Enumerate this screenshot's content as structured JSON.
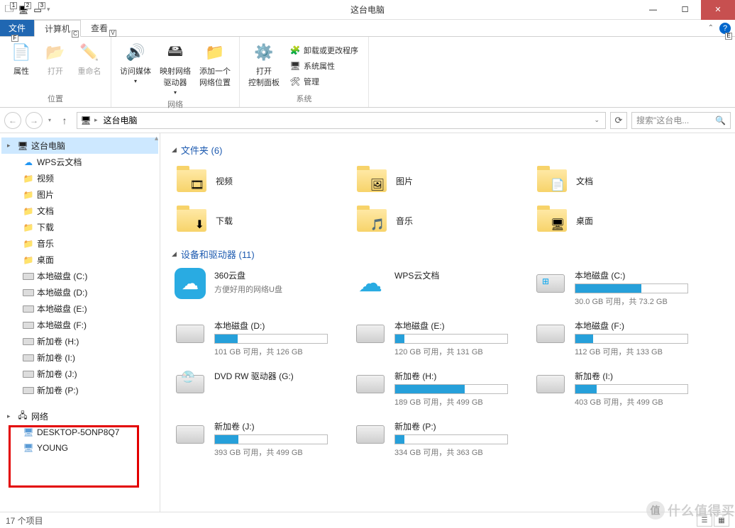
{
  "window": {
    "title": "这台电脑"
  },
  "qat_badges": [
    "1",
    "2",
    "3"
  ],
  "tabs": {
    "file": "文件",
    "file_key": "F",
    "computer": "计算机",
    "computer_key": "C",
    "view": "查看",
    "view_key": "V"
  },
  "help_key": "E",
  "ribbon": {
    "location_group": "位置",
    "network_group": "网络",
    "system_group": "系统",
    "properties": "属性",
    "open": "打开",
    "rename": "重命名",
    "access_media": "访问媒体",
    "map_drive": "映射网络\n驱动器",
    "add_location": "添加一个\n网络位置",
    "control_panel": "打开\n控制面板",
    "uninstall": "卸载或更改程序",
    "sys_props": "系统属性",
    "manage": "管理"
  },
  "addr": {
    "location": "这台电脑"
  },
  "search": {
    "placeholder": "搜索\"这台电..."
  },
  "tree": {
    "root": "这台电脑",
    "items": [
      {
        "label": "WPS云文档",
        "icon": "cloud"
      },
      {
        "label": "视频",
        "icon": "folder"
      },
      {
        "label": "图片",
        "icon": "folder"
      },
      {
        "label": "文档",
        "icon": "folder"
      },
      {
        "label": "下载",
        "icon": "folder"
      },
      {
        "label": "音乐",
        "icon": "folder"
      },
      {
        "label": "桌面",
        "icon": "folder"
      },
      {
        "label": "本地磁盘 (C:)",
        "icon": "drive"
      },
      {
        "label": "本地磁盘 (D:)",
        "icon": "drive"
      },
      {
        "label": "本地磁盘 (E:)",
        "icon": "drive"
      },
      {
        "label": "本地磁盘 (F:)",
        "icon": "drive"
      },
      {
        "label": "新加卷 (H:)",
        "icon": "drive"
      },
      {
        "label": "新加卷 (I:)",
        "icon": "drive"
      },
      {
        "label": "新加卷 (J:)",
        "icon": "drive"
      },
      {
        "label": "新加卷 (P:)",
        "icon": "drive"
      }
    ],
    "network": "网络",
    "net_items": [
      "DESKTOP-5ONP8Q7",
      "YOUNG"
    ]
  },
  "content": {
    "folders_hdr": "文件夹 (6)",
    "folders": [
      {
        "label": "视频",
        "overlay": "🎞"
      },
      {
        "label": "图片",
        "overlay": "🖼"
      },
      {
        "label": "文档",
        "overlay": "📄"
      },
      {
        "label": "下载",
        "overlay": "⬇"
      },
      {
        "label": "音乐",
        "overlay": "🎵"
      },
      {
        "label": "桌面",
        "overlay": "🖥"
      }
    ],
    "drives_hdr": "设备和驱动器 (11)",
    "drives": [
      {
        "type": "app",
        "name": "360云盘",
        "sub": "方便好用的网络U盘"
      },
      {
        "type": "cloud",
        "name": "WPS云文档",
        "sub": ""
      },
      {
        "type": "os",
        "name": "本地磁盘 (C:)",
        "sub": "30.0 GB 可用，共 73.2 GB",
        "fill": 59
      },
      {
        "type": "hdd",
        "name": "本地磁盘 (D:)",
        "sub": "101 GB 可用，共 126 GB",
        "fill": 20
      },
      {
        "type": "hdd",
        "name": "本地磁盘 (E:)",
        "sub": "120 GB 可用，共 131 GB",
        "fill": 8
      },
      {
        "type": "hdd",
        "name": "本地磁盘 (F:)",
        "sub": "112 GB 可用，共 133 GB",
        "fill": 16
      },
      {
        "type": "dvd",
        "name": "DVD RW 驱动器 (G:)",
        "sub": ""
      },
      {
        "type": "hdd",
        "name": "新加卷 (H:)",
        "sub": "189 GB 可用，共 499 GB",
        "fill": 62
      },
      {
        "type": "hdd",
        "name": "新加卷 (I:)",
        "sub": "403 GB 可用，共 499 GB",
        "fill": 19
      },
      {
        "type": "hdd",
        "name": "新加卷 (J:)",
        "sub": "393 GB 可用，共 499 GB",
        "fill": 21
      },
      {
        "type": "hdd",
        "name": "新加卷 (P:)",
        "sub": "334 GB 可用，共 363 GB",
        "fill": 8
      }
    ]
  },
  "status": {
    "count": "17 个项目"
  },
  "watermark": "什么值得买"
}
